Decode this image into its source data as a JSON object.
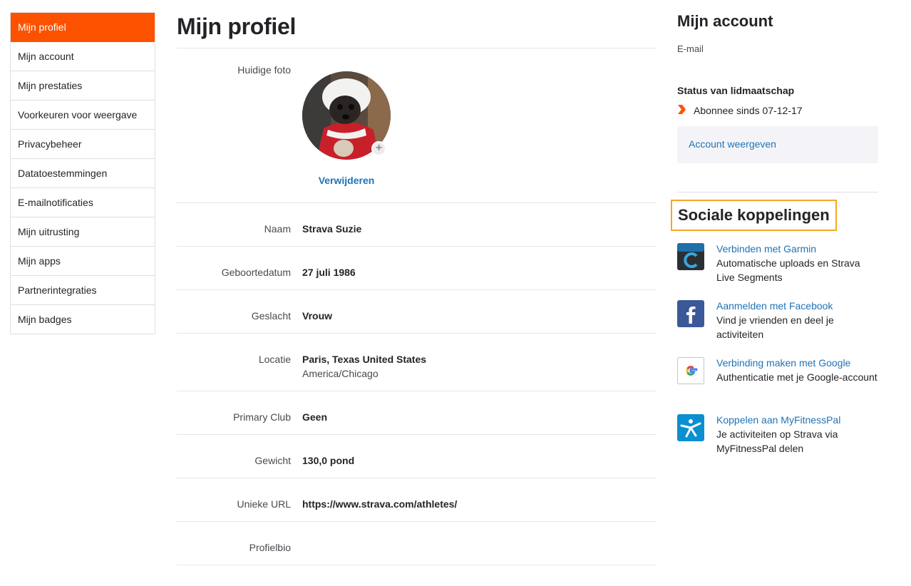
{
  "sidebar": {
    "items": [
      {
        "label": "Mijn profiel",
        "active": true
      },
      {
        "label": "Mijn account"
      },
      {
        "label": "Mijn prestaties"
      },
      {
        "label": "Voorkeuren voor weergave"
      },
      {
        "label": "Privacybeheer"
      },
      {
        "label": "Datatoestemmingen"
      },
      {
        "label": "E-mailnotificaties"
      },
      {
        "label": "Mijn uitrusting"
      },
      {
        "label": "Mijn apps"
      },
      {
        "label": "Partnerintegraties"
      },
      {
        "label": "Mijn badges"
      }
    ]
  },
  "main": {
    "title": "Mijn profiel",
    "photo": {
      "label": "Huidige foto",
      "remove_label": "Verwijderen",
      "add_icon": "+"
    },
    "fields": {
      "naam": {
        "label": "Naam",
        "value": "Strava Suzie"
      },
      "geboortedatum": {
        "label": "Geboortedatum",
        "value": "27 juli 1986"
      },
      "geslacht": {
        "label": "Geslacht",
        "value": "Vrouw"
      },
      "locatie": {
        "label": "Locatie",
        "value": "Paris, Texas United States",
        "sub": "America/Chicago"
      },
      "club": {
        "label": "Primary Club",
        "value": "Geen"
      },
      "gewicht": {
        "label": "Gewicht",
        "value": "130,0 pond"
      },
      "url": {
        "label": "Unieke URL",
        "value": "https://www.strava.com/athletes/"
      },
      "bio": {
        "label": "Profielbio",
        "value": ""
      }
    }
  },
  "account": {
    "title": "Mijn account",
    "email_label": "E-mail",
    "status_title": "Status van lidmaatschap",
    "status_text": "Abonnee sinds 07-12-17",
    "status_icon": "chevron-right-icon",
    "view_account": "Account weergeven"
  },
  "social": {
    "title": "Sociale koppelingen",
    "connections": [
      {
        "link": "Verbinden met Garmin",
        "desc": "Automatische uploads en Strava Live Segments",
        "icon": "garmin-icon"
      },
      {
        "link": "Aanmelden met Facebook",
        "desc": "Vind je vrienden en deel je activiteiten",
        "icon": "facebook-icon"
      },
      {
        "link": "Verbinding maken met Google",
        "desc": "Authenticatie met je Google-account",
        "icon": "google-icon"
      },
      {
        "link": "Koppelen aan MyFitnessPal",
        "desc": "Je activiteiten op Strava via MyFitnessPal delen",
        "icon": "myfitnesspal-icon"
      }
    ]
  },
  "colors": {
    "accent": "#fc5200",
    "link": "#1f73b7",
    "highlight_border": "#f5a623",
    "facebook": "#3b5998",
    "myfitnesspal": "#0b8fd1"
  }
}
